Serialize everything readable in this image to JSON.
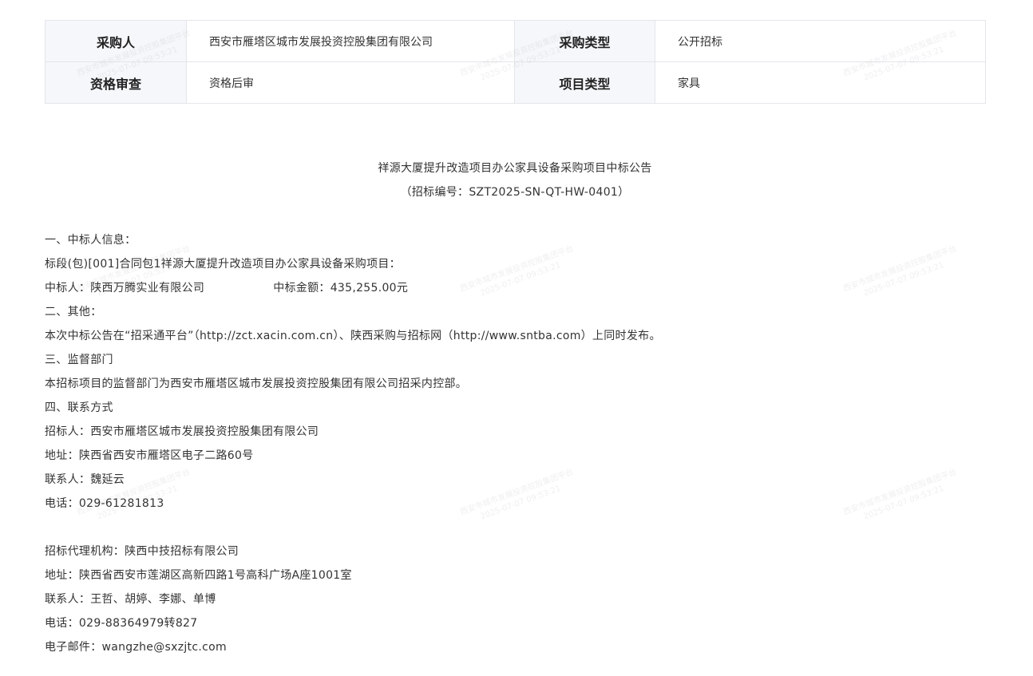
{
  "info_table": {
    "purchaser_label": "采购人",
    "purchaser_value": "西安市雁塔区城市发展投资控股集团有限公司",
    "purchase_type_label": "采购类型",
    "purchase_type_value": "公开招标",
    "qualification_label": "资格审查",
    "qualification_value": "资格后审",
    "project_type_label": "项目类型",
    "project_type_value": "家具"
  },
  "notice": {
    "title": "祥源大厦提升改造项目办公家具设备采购项目中标公告",
    "code": "（招标编号：SZT2025-SN-QT-HW-0401）",
    "section1_heading": "一、中标人信息：",
    "lot_line": "标段(包)[001]合同包1祥源大厦提升改造项目办公家具设备采购项目：",
    "winner_line": "中标人：陕西万腾实业有限公司",
    "amount_line": "中标金额：435,255.00元",
    "section2_heading": "二、其他：",
    "publish_line": "本次中标公告在“招采通平台”（http://zct.xacin.com.cn）、陕西采购与招标网（http://www.sntba.com）上同时发布。",
    "section3_heading": "三、监督部门",
    "supervision_line": "本招标项目的监督部门为西安市雁塔区城市发展投资控股集团有限公司招采内控部。",
    "section4_heading": "四、联系方式",
    "tenderer_line": "招标人：西安市雁塔区城市发展投资控股集团有限公司",
    "tenderer_address": "地址：陕西省西安市雁塔区电子二路60号",
    "tenderer_contact": "联系人：魏延云",
    "tenderer_phone": "电话：029-61281813",
    "agency_line": "招标代理机构：陕西中技招标有限公司",
    "agency_address": "地址：陕西省西安市莲湖区高新四路1号高科广场A座1001室",
    "agency_contact": "联系人：王哲、胡婷、李娜、单博",
    "agency_phone": "电话：029-88364979转827",
    "agency_email": "电子邮件：wangzhe@sxzjtc.com"
  },
  "watermark": {
    "line1": "西安市城市发展投资控股集团平台",
    "line2": "2025-07-07 09:53:21"
  }
}
